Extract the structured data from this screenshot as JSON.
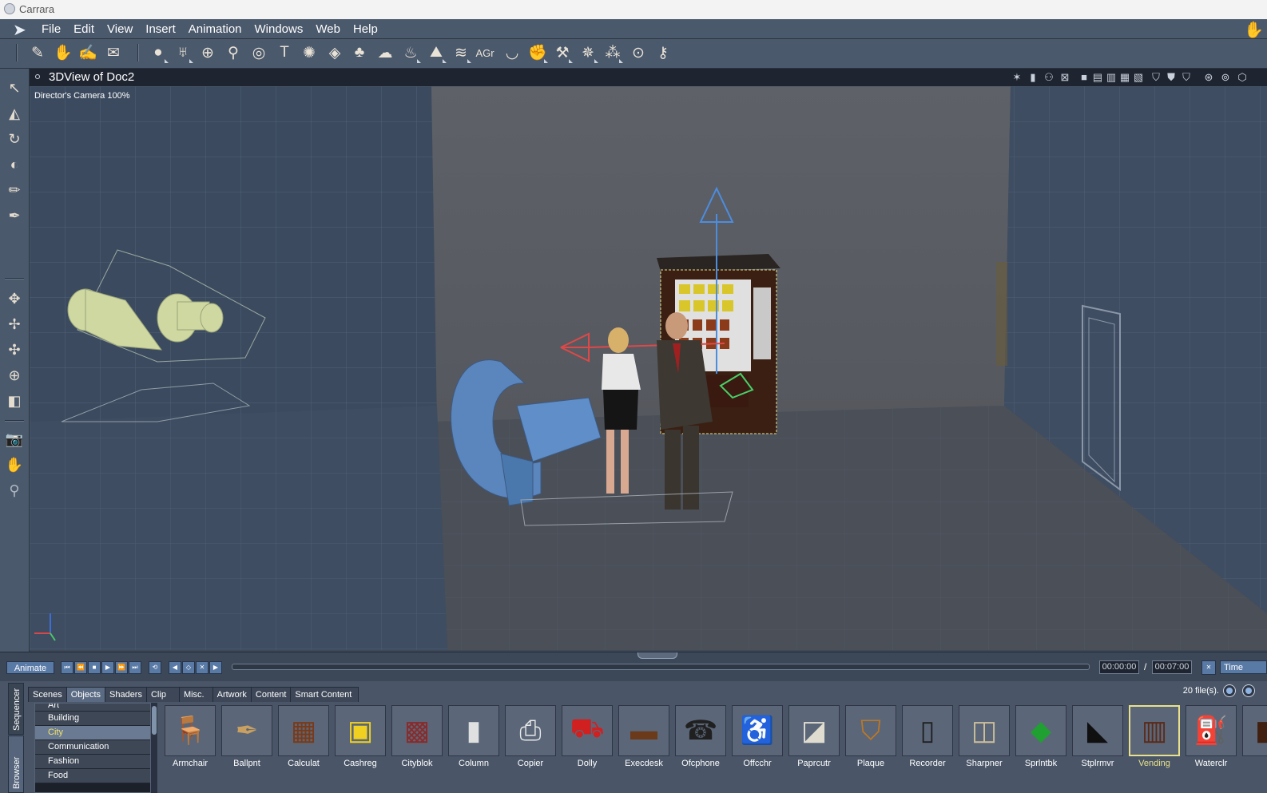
{
  "window": {
    "title": "Carrara"
  },
  "menu": [
    "File",
    "Edit",
    "View",
    "Insert",
    "Animation",
    "Windows",
    "Web",
    "Help"
  ],
  "toolbar": {
    "text_tool_glyph": "T",
    "agr_label": "AGr"
  },
  "view": {
    "title": "3DView of Doc2",
    "camera_label": "Director's Camera 100%"
  },
  "timeline": {
    "animate_label": "Animate",
    "current_time": "00:00:00",
    "separator": "/",
    "end_time": "00:07:00",
    "time_label": "Time"
  },
  "browser": {
    "side_tabs": [
      "Sequencer",
      "Browser"
    ],
    "tabs": [
      "Scenes",
      "Objects",
      "Shaders",
      "Clip",
      "Misc.",
      "Artwork",
      "Content",
      "Smart Content"
    ],
    "active_tab": "Objects",
    "file_count": "20 file(s).",
    "categories": [
      "Art",
      "Building",
      "City",
      "Communication",
      "Fashion",
      "Food"
    ],
    "selected_category": "City",
    "items": [
      "Armchair",
      "Ballpnt",
      "Calculat",
      "Cashreg",
      "Cityblok",
      "Column",
      "Copier",
      "Dolly",
      "Execdesk",
      "Ofcphone",
      "Offcchr",
      "Paprcutr",
      "Plaque",
      "Recorder",
      "Sharpner",
      "Sprlntbk",
      "Stplrmvr",
      "Vending",
      "Waterclr"
    ],
    "selected_item": "Vending"
  },
  "icons": {
    "item_icons": [
      "armchair-icon",
      "pen-icon",
      "calculator-icon",
      "cash-register-icon",
      "city-block-icon",
      "column-icon",
      "copier-icon",
      "dolly-icon",
      "desk-icon",
      "phone-icon",
      "office-chair-icon",
      "paper-cutter-icon",
      "plaque-icon",
      "recorder-icon",
      "sharpener-icon",
      "notebook-icon",
      "stapler-icon",
      "vending-icon",
      "water-cooler-icon"
    ]
  },
  "colors": {
    "accent_selected": "#e8e08a",
    "chrome": "#4b596c",
    "viewport_floor": "#4a4f58"
  }
}
